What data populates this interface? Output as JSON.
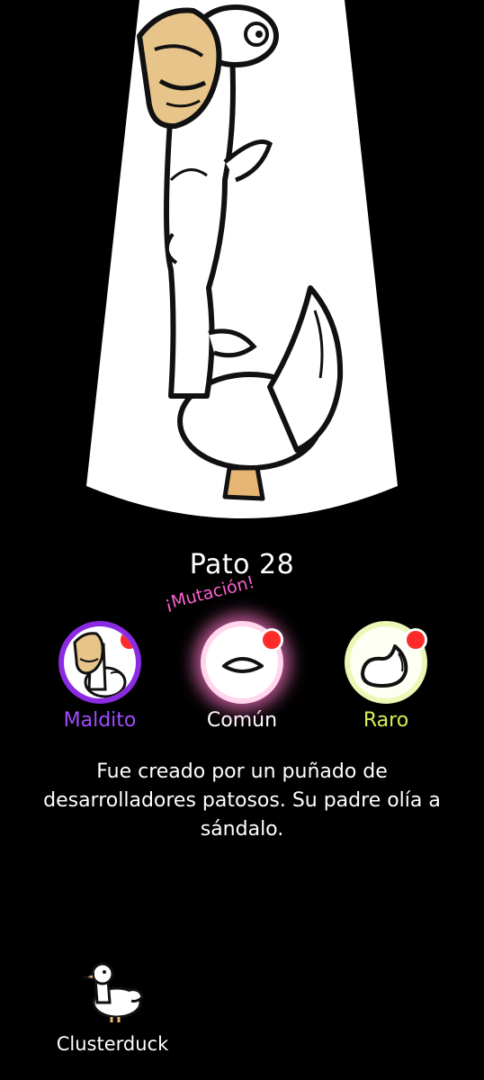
{
  "duck": {
    "name": "Pato 28",
    "mutation_label": "¡Mutación!",
    "traits": [
      {
        "label": "Maldito",
        "label_color": "#a24bff",
        "icon": "cursed-mask-duck-icon",
        "has_alert": true
      },
      {
        "label": "Común",
        "label_color": "#ffffff",
        "icon": "plain-eye-icon",
        "has_alert": true
      },
      {
        "label": "Raro",
        "label_color": "#d6ef5a",
        "icon": "rare-tail-icon",
        "has_alert": true
      }
    ],
    "description": "Fue creado por un puñado de desarrolladores patosos. Su padre olía a sándalo."
  },
  "footer": {
    "game_name": "Clusterduck",
    "icon": "clusterduck-logo-duck-icon"
  },
  "colors": {
    "background": "#000000",
    "spotlight": "#ffffff",
    "cursed": "#8a2be2",
    "mutation": "#ff5fd2",
    "rare": "#d6ef5a",
    "alert": "#ff2a2a"
  }
}
